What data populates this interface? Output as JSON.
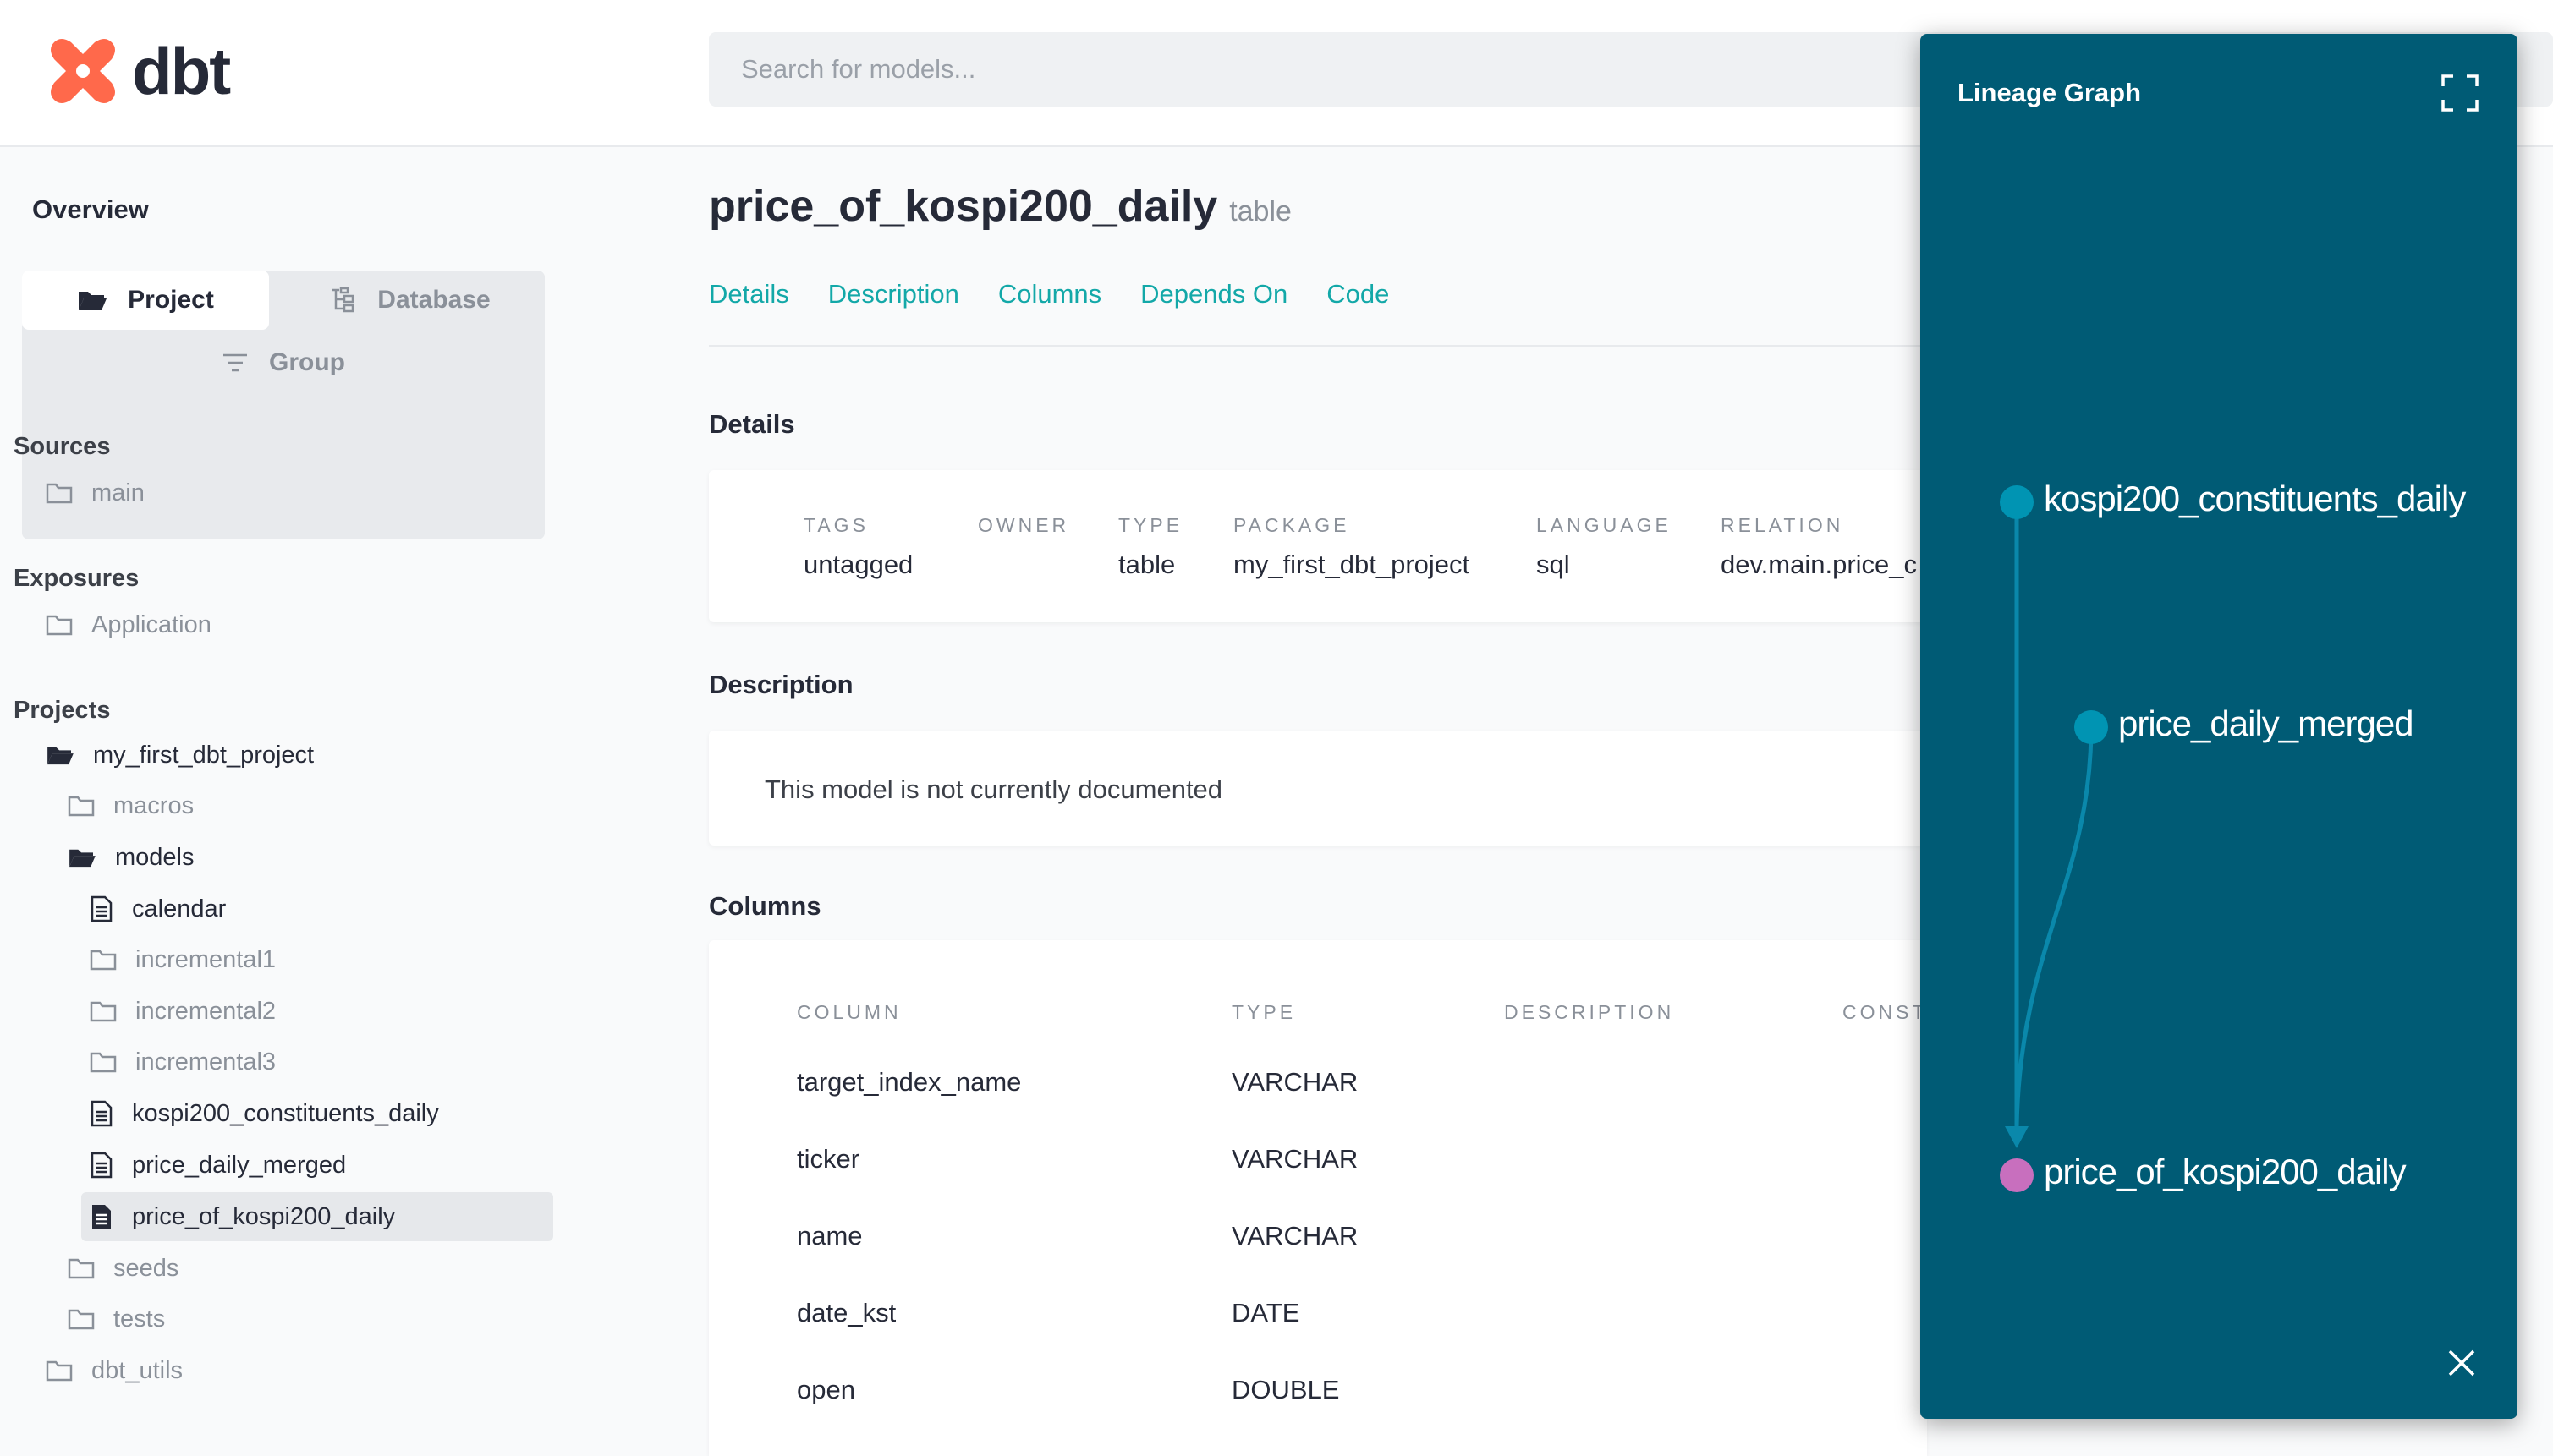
{
  "header": {
    "logo_text": "dbt",
    "search_placeholder": "Search for models..."
  },
  "sidebar": {
    "overview": "Overview",
    "tabs": {
      "project": "Project",
      "database": "Database",
      "group": "Group"
    },
    "sources": {
      "title": "Sources",
      "items": [
        "main"
      ]
    },
    "exposures": {
      "title": "Exposures",
      "items": [
        "Application"
      ]
    },
    "projects": {
      "title": "Projects",
      "root": "my_first_dbt_project",
      "macros": "macros",
      "models": "models",
      "model_items": [
        "calendar",
        "incremental1",
        "incremental2",
        "incremental3",
        "kospi200_constituents_daily",
        "price_daily_merged",
        "price_of_kospi200_daily"
      ],
      "seeds": "seeds",
      "tests": "tests",
      "dbt_utils": "dbt_utils"
    }
  },
  "main": {
    "title": "price_of_kospi200_daily",
    "title_type": "table",
    "nav_tabs": [
      "Details",
      "Description",
      "Columns",
      "Depends On",
      "Code"
    ],
    "details": {
      "heading": "Details",
      "fields": [
        {
          "label": "TAGS",
          "value": "untagged"
        },
        {
          "label": "OWNER",
          "value": ""
        },
        {
          "label": "TYPE",
          "value": "table"
        },
        {
          "label": "PACKAGE",
          "value": "my_first_dbt_project"
        },
        {
          "label": "LANGUAGE",
          "value": "sql"
        },
        {
          "label": "RELATION",
          "value": "dev.main.price_c"
        }
      ]
    },
    "description": {
      "heading": "Description",
      "text": "This model is not currently documented"
    },
    "columns": {
      "heading": "Columns",
      "headers": [
        "COLUMN",
        "TYPE",
        "DESCRIPTION",
        "CONST"
      ],
      "rows": [
        [
          "target_index_name",
          "VARCHAR"
        ],
        [
          "ticker",
          "VARCHAR"
        ],
        [
          "name",
          "VARCHAR"
        ],
        [
          "date_kst",
          "DATE"
        ],
        [
          "open",
          "DOUBLE"
        ]
      ]
    }
  },
  "lineage": {
    "title": "Lineage Graph",
    "nodes": [
      "kospi200_constituents_daily",
      "price_daily_merged",
      "price_of_kospi200_daily"
    ],
    "colors": {
      "panel": "#005b75",
      "parent_node": "#0094b3",
      "current_node": "#c86fbe",
      "edge": "#0a88ab"
    }
  },
  "colors": {
    "accent": "#13a8a8",
    "brand": "#ff694b"
  }
}
